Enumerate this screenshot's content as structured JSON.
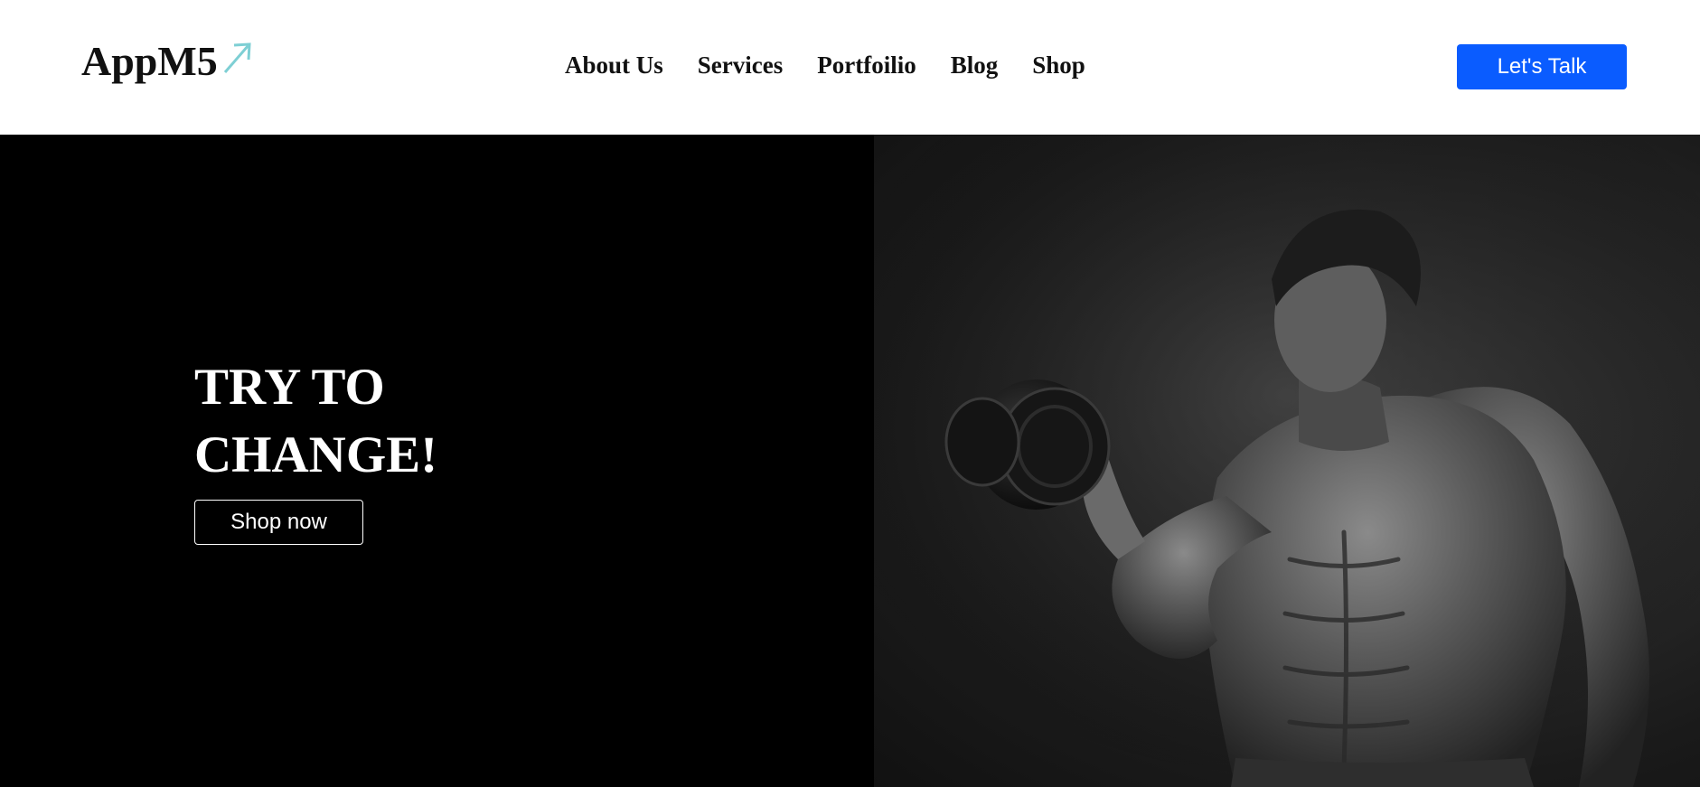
{
  "header": {
    "logo": {
      "text": "AppM5",
      "icon": "arrow-up-right-icon",
      "icon_color": "#7ecfd4"
    },
    "nav": [
      {
        "label": "About Us"
      },
      {
        "label": "Services"
      },
      {
        "label": "Portfoilio"
      },
      {
        "label": "Blog"
      },
      {
        "label": "Shop"
      }
    ],
    "cta_label": "Let's Talk",
    "cta_color": "#0a5cff"
  },
  "hero": {
    "title_lines": [
      "TRY TO",
      "CHANGE!"
    ],
    "button_label": "Shop now",
    "left_background": "#000000",
    "image": {
      "icon": "bodybuilder-dumbbell-photo"
    }
  }
}
